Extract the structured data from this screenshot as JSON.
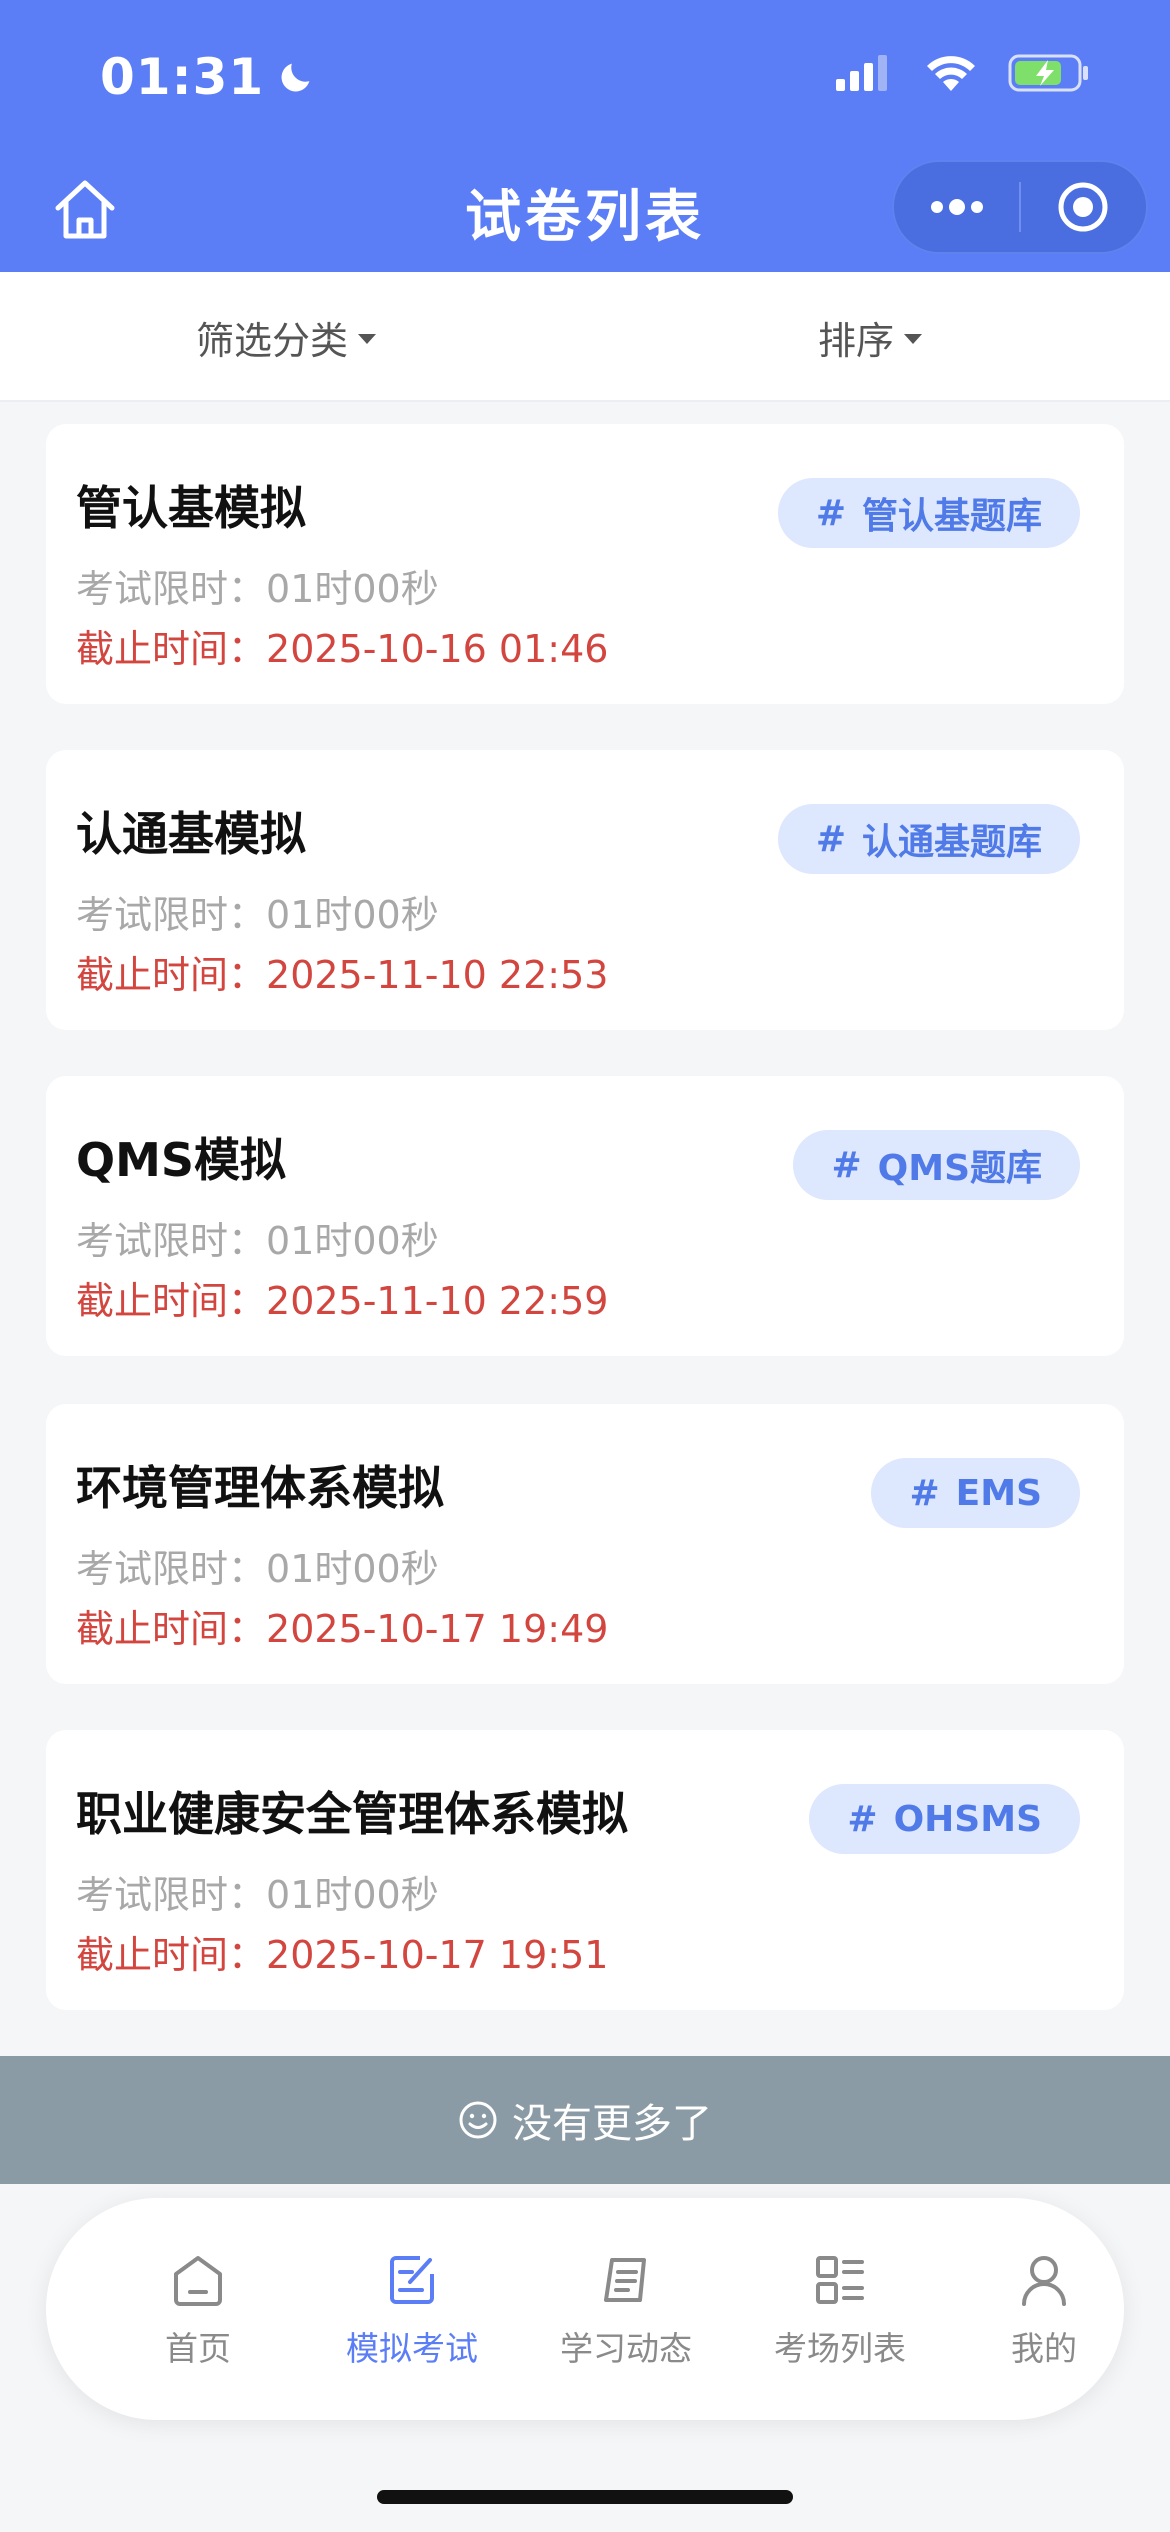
{
  "status_bar": {
    "time": "01:31"
  },
  "nav": {
    "title": "试卷列表"
  },
  "filters": {
    "category": "筛选分类",
    "sort": "排序"
  },
  "exams": [
    {
      "title": "管认基模拟",
      "tag": "管认基题库",
      "time_limit_label": "考试限时：",
      "time_limit": "01时00秒",
      "deadline_label": "截止时间：",
      "deadline": "2025-10-16 01:46"
    },
    {
      "title": "认通基模拟",
      "tag": "认通基题库",
      "time_limit_label": "考试限时：",
      "time_limit": "01时00秒",
      "deadline_label": "截止时间：",
      "deadline": "2025-11-10 22:53"
    },
    {
      "title": "QMS模拟",
      "tag": "QMS题库",
      "time_limit_label": "考试限时：",
      "time_limit": "01时00秒",
      "deadline_label": "截止时间：",
      "deadline": "2025-11-10 22:59"
    },
    {
      "title": "环境管理体系模拟",
      "tag": "EMS",
      "time_limit_label": "考试限时：",
      "time_limit": "01时00秒",
      "deadline_label": "截止时间：",
      "deadline": "2025-10-17 19:49"
    },
    {
      "title": "职业健康安全管理体系模拟",
      "tag": "OHSMS",
      "time_limit_label": "考试限时：",
      "time_limit": "01时00秒",
      "deadline_label": "截止时间：",
      "deadline": "2025-10-17 19:51"
    }
  ],
  "tag_prefix": "#",
  "no_more": {
    "icon": "smile-icon",
    "text": "没有更多了"
  },
  "tabbar": {
    "items": [
      {
        "label": "首页",
        "icon": "home-icon",
        "active": false
      },
      {
        "label": "模拟考试",
        "icon": "edit-document-icon",
        "active": true
      },
      {
        "label": "学习动态",
        "icon": "notebook-icon",
        "active": false
      },
      {
        "label": "考场列表",
        "icon": "list-grid-icon",
        "active": false
      },
      {
        "label": "我的",
        "icon": "user-icon",
        "active": false
      }
    ]
  },
  "colors": {
    "primary": "#5b7ef6",
    "deadline_red": "#d2463f",
    "tag_bg": "#dde7fd",
    "no_more_bg": "#8b9ba5"
  }
}
